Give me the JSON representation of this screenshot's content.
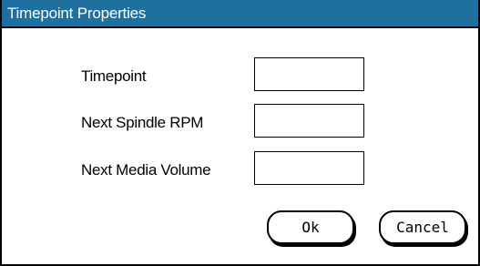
{
  "window": {
    "title": "Timepoint Properties"
  },
  "form": {
    "timepoint_label": "Timepoint",
    "timepoint_value": "",
    "spindle_label": "Next Spindle RPM",
    "spindle_value": "",
    "volume_label": "Next Media Volume",
    "volume_value": ""
  },
  "buttons": {
    "ok_label": "Ok",
    "cancel_label": "Cancel"
  },
  "colors": {
    "titlebar": "#1f6f9f",
    "title_text": "#ffffff",
    "border": "#000000",
    "background": "#ffffff"
  }
}
